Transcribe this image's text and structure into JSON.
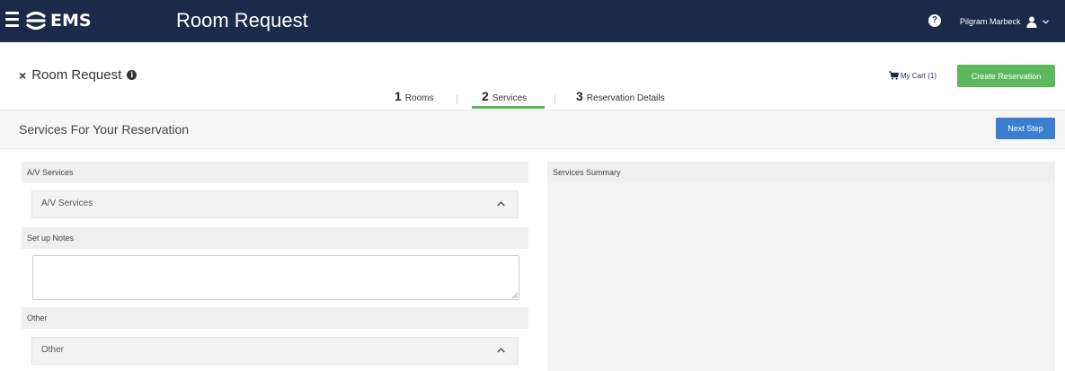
{
  "topbar": {
    "logo_text": "EMS",
    "app_title": "Room Request",
    "help_glyph": "?",
    "user_name": "Pilgram Marbeck",
    "colors": {
      "background": "#1c2a4a",
      "foreground": "#ffffff"
    },
    "icons": [
      "menu-icon",
      "ems-logo-icon",
      "help-icon",
      "user-icon",
      "chevron-down-icon"
    ]
  },
  "page": {
    "close_glyph": "×",
    "title": "Room Request",
    "info_glyph": "i",
    "cart_label": "My Cart (1)",
    "create_button_label": "Create Reservation",
    "colors": {
      "create_button": "#5cb85c",
      "next_button": "#3a7ecf",
      "active_step_underline": "#5cb85c"
    }
  },
  "steps": [
    {
      "number": "1",
      "label": "Rooms",
      "active": false
    },
    {
      "number": "2",
      "label": "Services",
      "active": true
    },
    {
      "number": "3",
      "label": "Reservation Details",
      "active": false
    }
  ],
  "section": {
    "title": "Services For Your Reservation",
    "next_button_label": "Next Step"
  },
  "left": {
    "av_header": "A/V Services",
    "av_accordion_label": "A/V Services",
    "setup_notes_header": "Set up Notes",
    "setup_notes_value": "",
    "other_header": "Other",
    "other_accordion_label": "Other"
  },
  "right": {
    "summary_header": "Services Summary"
  }
}
